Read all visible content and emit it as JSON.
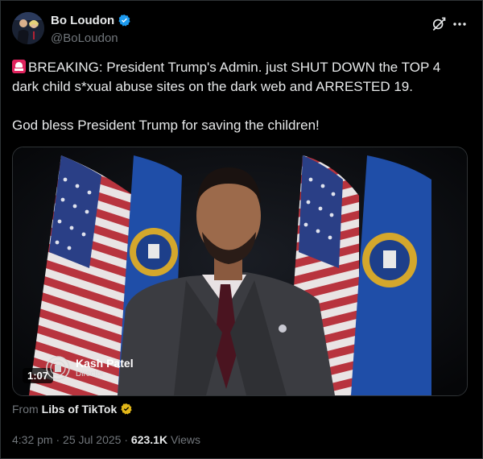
{
  "author": {
    "display_name": "Bo Loudon",
    "handle": "@BoLoudon",
    "verified": true
  },
  "tweet": {
    "line1": "BREAKING: President Trump's Admin. just SHUT DOWN the TOP 4",
    "line2": "dark child s*xual abuse sites on the dark web and ARRESTED 19.",
    "line3": "God bless President Trump for saving the children!",
    "emoji": "rotating-light-icon"
  },
  "video": {
    "duration": "1:07",
    "lower_third_name": "Kash Patel",
    "lower_third_title": "Director"
  },
  "source": {
    "prefix": "From",
    "name": "Libs of TikTok",
    "badge": "gold-verified-icon"
  },
  "meta": {
    "time": "4:32 pm",
    "sep1": "·",
    "date": "25 Jul 2025",
    "sep2": "·",
    "views_count": "623.1K",
    "views_label": "Views"
  },
  "colors": {
    "background": "#000000",
    "text": "#e7e9ea",
    "muted": "#71767b",
    "verified_blue": "#1d9bf0",
    "gold_badge": "#e2b719"
  }
}
